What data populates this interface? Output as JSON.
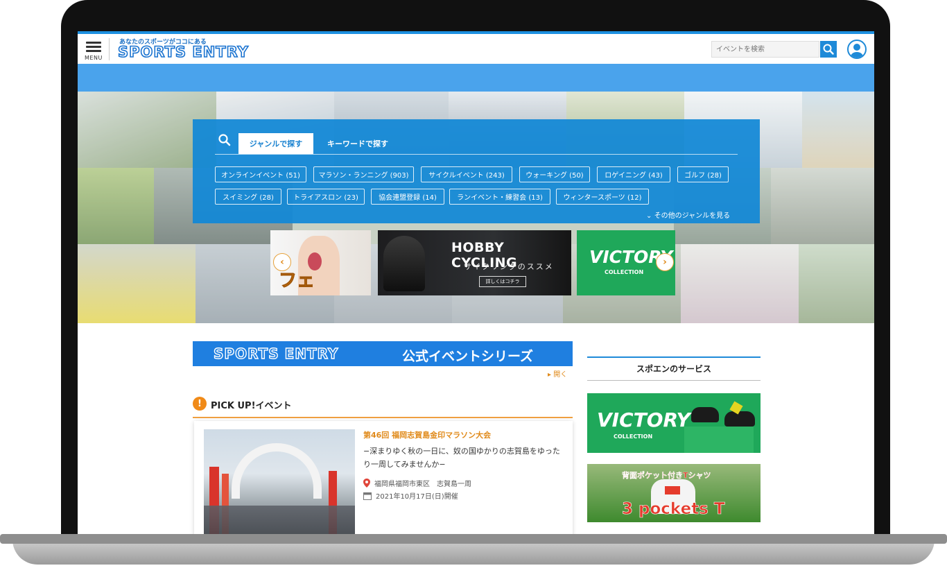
{
  "header": {
    "menu_label": "MENU",
    "tagline": "あなたのスポーツがココにある",
    "logo_text": "SPORTS ENTRY",
    "search_placeholder": "イベントを検索"
  },
  "genre_search": {
    "tabs": [
      "ジャンルで探す",
      "キーワードで探す"
    ],
    "genres": [
      "オンラインイベント (51)",
      "マラソン・ランニング (903)",
      "サイクルイベント (243)",
      "ウォーキング (50)",
      "ロゲイニング (43)",
      "ゴルフ (28)",
      "スイミング (28)",
      "トライアスロン (23)",
      "協会連盟登録 (14)",
      "ランイベント・練習会 (13)",
      "ウィンタースポーツ (12)"
    ],
    "more_label": "その他のジャンルを見る"
  },
  "carousel": {
    "banner1_text": "フェ",
    "banner2_title": "HOBBY CYCLING",
    "banner2_sub": "サイクリングのススメ",
    "banner2_button": "詳しくはコチラ",
    "banner3_title": "VICTORY",
    "banner3_sub": "COLLECTION",
    "prev": "‹",
    "next": "›"
  },
  "series": {
    "logo_text": "SPORTS ENTRY",
    "title": "公式イベントシリーズ",
    "open_label": "開く"
  },
  "pickup": {
    "icon": "!",
    "title": "PICK UP!イベント",
    "event": {
      "title": "第46回 福岡志賀島金印マラソン大会",
      "desc": "−深まりゆく秋の一日に、奴の国ゆかりの志賀島をゆったり一周してみませんか−",
      "location": "福岡県福岡市東区　志賀島一周",
      "date": "2021年10月17日(日)開催"
    }
  },
  "services": {
    "title": "スポエンのサービス",
    "victory_title": "VICTORY",
    "victory_sub": "COLLECTION",
    "tshirt_caption": "背面ポケット付きTシャツ",
    "tshirt_title": "3 pockets T"
  },
  "colors": {
    "brand_blue": "#1e8ad8",
    "accent_orange": "#e08a1a",
    "victory_green": "#1fa85a"
  }
}
